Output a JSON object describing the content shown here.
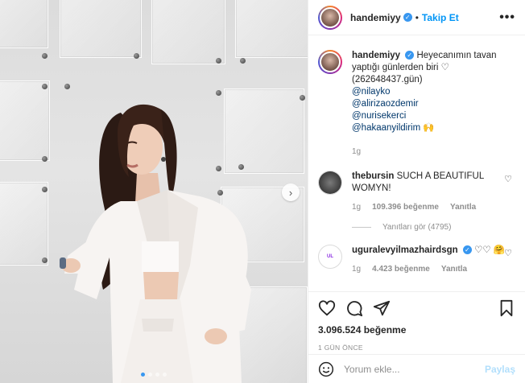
{
  "header": {
    "username": "handemiyy",
    "separator": "•",
    "follow_label": "Takip Et",
    "more_label": "•••"
  },
  "caption": {
    "username": "handemiyy",
    "text": "Heyecanımın tavan yaptığı günlerden biri ♡ (262648437.gün)",
    "mentions": [
      "@nilayko",
      "@alirizaozdemir",
      "@nurisekerci",
      "@hakaanyildirim 🙌"
    ],
    "time": "1g"
  },
  "comments": [
    {
      "username": "thebursin",
      "text": "SUCH A BEAUTIFUL WOMYN!",
      "time": "1g",
      "likes": "109.396 beğenme",
      "reply_label": "Yanıtla",
      "view_replies": "Yanıtları gör (4795)"
    },
    {
      "username": "uguralevyilmazhairdsgn",
      "text": "♡♡ 🤗",
      "time": "1g",
      "likes": "4.423 beğenme",
      "reply_label": "Yanıtla",
      "avatar_text": "UL"
    }
  ],
  "post": {
    "likes": "3.096.524 beğenme",
    "time_ago": "1 GÜN ÖNCE"
  },
  "add_comment": {
    "placeholder": "Yorum ekle...",
    "post_label": "Paylaş"
  },
  "carousel": {
    "total": 4,
    "active": 1
  },
  "colors": {
    "accent": "#0095f6",
    "verified": "#3897f0",
    "muted": "#8e8e8e"
  }
}
